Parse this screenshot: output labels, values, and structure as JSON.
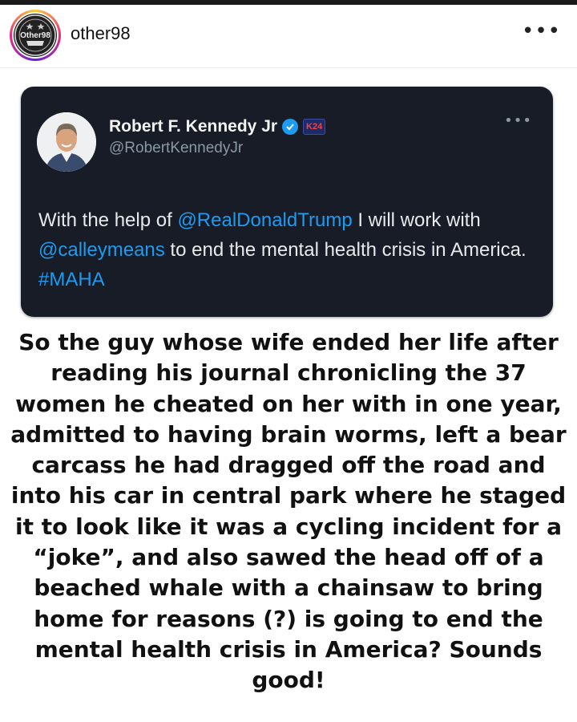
{
  "post": {
    "username": "other98",
    "avatar_text": "Other98",
    "menu_icon": "more-dots-icon"
  },
  "tweet": {
    "author_name": "Robert F. Kennedy Jr",
    "handle": "@RobertKennedyJr",
    "badge_text": "K24",
    "body_parts": [
      {
        "text": "With the help of ",
        "link": false
      },
      {
        "text": "@RealDonaldTrump",
        "link": true
      },
      {
        "text": " I will work with ",
        "link": false
      },
      {
        "text": "@calleymeans",
        "link": true
      },
      {
        "text": " to end the mental health crisis in America. ",
        "link": false
      },
      {
        "text": "#MAHA",
        "link": true
      }
    ]
  },
  "caption": "So the guy whose wife ended her life after reading his journal chronicling the 37 women he cheated on her with in one year, admitted to having brain worms, left a bear carcass he had dragged off the road and into his car in central park where he staged it to look like it was a cycling incident for a “joke”, and also sawed the head off of a beached whale with a chainsaw to bring home for reasons (?) is going to end the mental health crisis in America? Sounds good!",
  "colors": {
    "tweet_bg": "#171c26",
    "link": "#1d9bf0",
    "verified": "#1d9bf0"
  }
}
